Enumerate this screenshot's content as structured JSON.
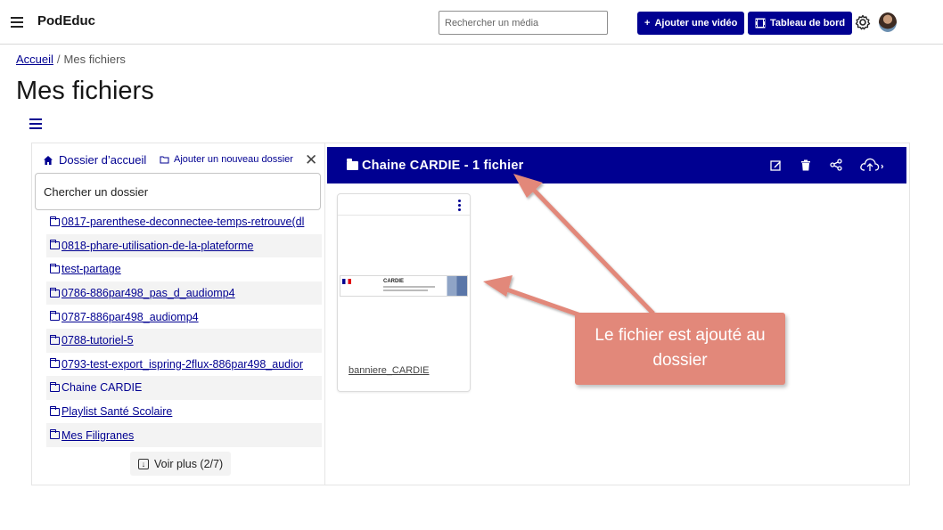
{
  "app": {
    "title": "PodEduc"
  },
  "header": {
    "search_placeholder": "Rechercher un média",
    "add_video_label": "Ajouter une vidéo",
    "dashboard_label": "Tableau de bord"
  },
  "breadcrumb": {
    "home": "Accueil",
    "separator": "/",
    "current": "Mes fichiers"
  },
  "page": {
    "title": "Mes fichiers"
  },
  "tree": {
    "home_label": "Dossier d’accueil",
    "add_folder_label": "Ajouter un nouveau dossier",
    "close_glyph": "✕",
    "search_placeholder": "Chercher un dossier",
    "folders": [
      "0817-parenthese-deconnectee-temps-retrouve(dl",
      "0818-phare-utilisation-de-la-plateforme",
      "test-partage",
      "0786-886par498_pas_d_audiomp4",
      "0787-886par498_audiomp4",
      "0788-tutoriel-5",
      "0793-test-export_ispring-2flux-886par498_audior",
      "Chaine CARDIE",
      "Playlist Santé Scolaire",
      "Mes Filigranes"
    ],
    "more_label": "Voir plus (2/7)"
  },
  "folder_view": {
    "title": "Chaine CARDIE - 1 fichier",
    "actions": [
      "edit-icon",
      "trash-icon",
      "share-icon",
      "cloud-upload-icon"
    ],
    "files": [
      {
        "name": "banniere_CARDIE",
        "thumb_text": "CARDIE"
      }
    ]
  },
  "annotation": {
    "text": "Le fichier est ajouté au dossier",
    "color": "#e2887a"
  },
  "colors": {
    "primary": "#000091",
    "annotation": "#e2887a"
  }
}
